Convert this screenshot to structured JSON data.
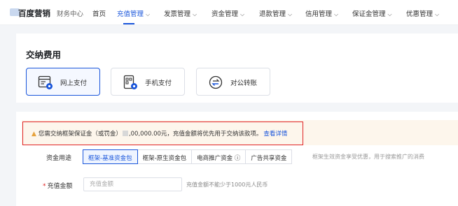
{
  "header": {
    "brand": "百度营销",
    "brand_sub": "财务中心",
    "nav": [
      {
        "label": "首页",
        "has_dropdown": false,
        "active": false
      },
      {
        "label": "充值管理",
        "has_dropdown": true,
        "active": true
      },
      {
        "label": "发票管理",
        "has_dropdown": true,
        "active": false
      },
      {
        "label": "资金管理",
        "has_dropdown": true,
        "active": false
      },
      {
        "label": "退款管理",
        "has_dropdown": true,
        "active": false
      },
      {
        "label": "信用管理",
        "has_dropdown": true,
        "active": false
      },
      {
        "label": "保证金管理",
        "has_dropdown": true,
        "active": false
      },
      {
        "label": "优惠管理",
        "has_dropdown": true,
        "active": false
      }
    ]
  },
  "payment": {
    "title": "交纳费用",
    "options": [
      {
        "label": "网上支付",
        "icon": "online-payment-icon",
        "selected": true
      },
      {
        "label": "手机支付",
        "icon": "mobile-payment-icon",
        "selected": false
      },
      {
        "label": "对公转账",
        "icon": "bank-transfer-icon",
        "selected": false
      }
    ]
  },
  "notice": {
    "before": "您需交纳框架保证金（或罚金）",
    "amount": ",00,000.00元，充值金额将优先用于交纳该款项。",
    "link": "查看详情"
  },
  "fund_usage": {
    "label": "资金用途",
    "options": [
      {
        "label": "框架-基准资金包",
        "selected": true
      },
      {
        "label": "框架-原生资金包",
        "selected": false
      },
      {
        "label": "电商推广资金 ⓘ",
        "selected": false
      },
      {
        "label": "广告共享资金",
        "selected": false
      }
    ],
    "hint": "框架生效资金享受优惠，用于搜索推广的消费"
  },
  "amount": {
    "label": "充值金额",
    "required": true,
    "placeholder": "充值金额",
    "value": "",
    "hint": "充值金额不能少于1000元人民币"
  },
  "colors": {
    "accent": "#1a56db",
    "warning": "#e6a23c",
    "highlight_border": "#e02424",
    "notice_bg": "#fdf6ec"
  }
}
